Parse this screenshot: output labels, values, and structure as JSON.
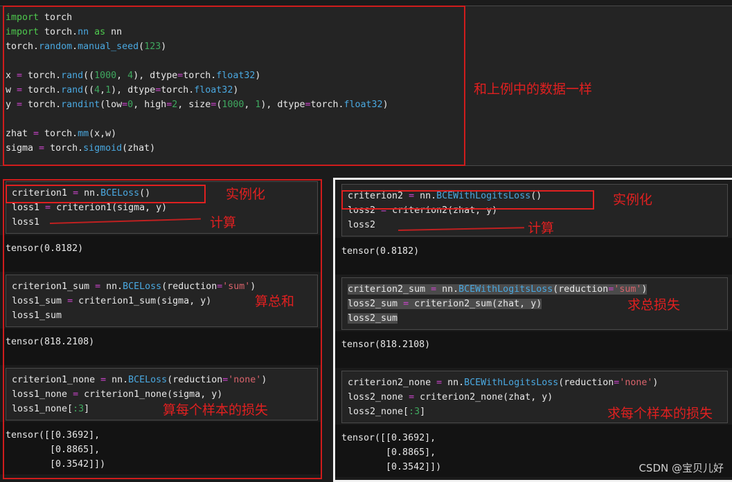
{
  "watermark": "CSDN @宝贝儿好",
  "top_cell": {
    "lines": [
      "import torch",
      "import torch.nn as nn",
      "torch.random.manual_seed(123)",
      "",
      "x = torch.rand((1000, 4), dtype=torch.float32)",
      "w = torch.rand((4,1), dtype=torch.float32)",
      "y = torch.randint(low=0, high=2, size=(1000, 1), dtype=torch.float32)",
      "",
      "zhat = torch.mm(x,w)",
      "sigma = torch.sigmoid(zhat)"
    ],
    "annotation": "和上例中的数据一样"
  },
  "left_column": {
    "cells": [
      {
        "code": [
          "criterion1 = nn.BCELoss()",
          "loss1 = criterion1(sigma, y)",
          "loss1"
        ],
        "output": [
          "tensor(0.8182)"
        ],
        "annotations": [
          "实例化",
          "计算"
        ]
      },
      {
        "code": [
          "criterion1_sum = nn.BCELoss(reduction='sum')",
          "loss1_sum = criterion1_sum(sigma, y)",
          "loss1_sum"
        ],
        "output": [
          "tensor(818.2108)"
        ],
        "annotations": [
          "算总和"
        ]
      },
      {
        "code": [
          "criterion1_none = nn.BCELoss(reduction='none')",
          "loss1_none = criterion1_none(sigma, y)",
          "loss1_none[:3]"
        ],
        "output": [
          "tensor([[0.3692],",
          "        [0.8865],",
          "        [0.3542]])"
        ],
        "annotations": [
          "算每个样本的损失"
        ]
      }
    ]
  },
  "right_column": {
    "cells": [
      {
        "code": [
          "criterion2 = nn.BCEWithLogitsLoss()",
          "loss2 = criterion2(zhat, y)",
          "loss2"
        ],
        "output": [
          "tensor(0.8182)"
        ],
        "annotations": [
          "实例化",
          "计算"
        ]
      },
      {
        "code": [
          "criterion2_sum = nn.BCEWithLogitsLoss(reduction='sum')",
          "loss2_sum = criterion2_sum(zhat, y)",
          "loss2_sum"
        ],
        "output": [
          "tensor(818.2108)"
        ],
        "annotations": [
          "求总损失"
        ]
      },
      {
        "code": [
          "criterion2_none = nn.BCEWithLogitsLoss(reduction='none')",
          "loss2_none = criterion2_none(zhat, y)",
          "loss2_none[:3]"
        ],
        "output": [
          "tensor([[0.3692],",
          "        [0.8865],",
          "        [0.3542]])"
        ],
        "annotations": [
          "求每个样本的损失"
        ]
      }
    ]
  },
  "colors": {
    "annotation_red": "#e02020",
    "keyword_green": "#4ec94e",
    "function_blue": "#4aa8e0",
    "operator_magenta": "#cc44cc",
    "number_green": "#3fa85f",
    "string_red": "#d9636b",
    "code_background": "#242424",
    "output_background": "#131313"
  }
}
